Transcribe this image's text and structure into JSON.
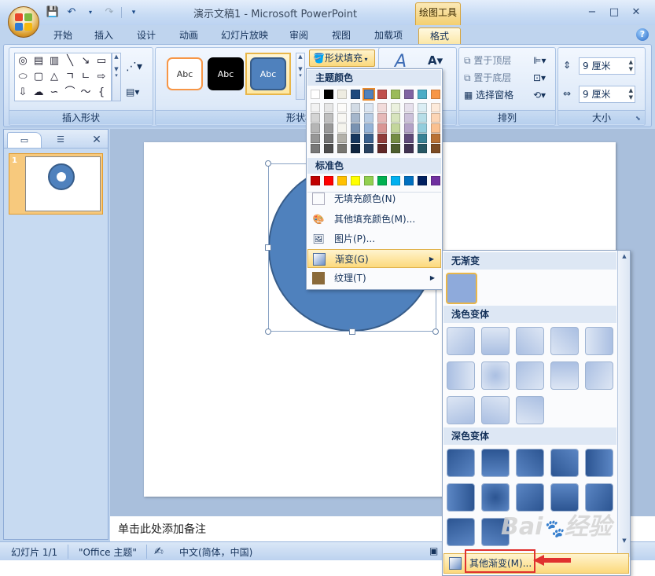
{
  "titlebar": {
    "title": "演示文稿1 - Microsoft PowerPoint",
    "contextual_tab": "绘图工具",
    "minimize": "−",
    "maximize": "□",
    "close": "✕"
  },
  "qat": {
    "save_icon": "save-icon",
    "undo_icon": "undo-icon",
    "redo_icon": "redo-icon",
    "customize": "▾"
  },
  "tabs": [
    "开始",
    "插入",
    "设计",
    "动画",
    "幻灯片放映",
    "审阅",
    "视图",
    "加载项",
    "格式"
  ],
  "active_tab": "格式",
  "ribbon": {
    "groups": {
      "insert_shapes": "插入形状",
      "shape_styles": "形状样式",
      "arrange": "排列",
      "size": "大小"
    },
    "style_thumbs": [
      "Abc",
      "Abc",
      "Abc"
    ],
    "shape_fill": "形状填充",
    "bring_to_front": "置于顶层",
    "send_to_back": "置于底层",
    "selection_pane": "选择窗格",
    "height": "9 厘米",
    "width": "9 厘米"
  },
  "fill_menu": {
    "theme_colors": "主题颜色",
    "standard_colors": "标准色",
    "no_fill": "无填充颜色(N)",
    "more_colors": "其他填充颜色(M)...",
    "picture": "图片(P)...",
    "gradient": "渐变(G)",
    "texture": "纹理(T)",
    "theme_top_row": [
      "#ffffff",
      "#000000",
      "#eeece1",
      "#1f497d",
      "#4f81bd",
      "#c0504d",
      "#9bbb59",
      "#8064a2",
      "#4bacc6",
      "#f79646"
    ],
    "standard_row": [
      "#c00000",
      "#ff0000",
      "#ffc000",
      "#ffff00",
      "#92d050",
      "#00b050",
      "#00b0f0",
      "#0070c0",
      "#002060",
      "#7030a0"
    ]
  },
  "gradient_menu": {
    "no_gradient": "无渐变",
    "light_variations": "浅色变体",
    "dark_variations": "深色变体",
    "more_gradients": "其他渐变(M)..."
  },
  "slides_pane": {
    "slide_number": "1",
    "close": "✕"
  },
  "notes_placeholder": "单击此处添加备注",
  "status": {
    "slide": "幻灯片 1/1",
    "theme": "\"Office 主题\"",
    "language": "中文(简体，中国)"
  },
  "colors": {
    "accent": "#4f81bd",
    "shape_border": "#385d8a",
    "highlight": "#e0312f"
  },
  "watermark": "Baidu 经验"
}
